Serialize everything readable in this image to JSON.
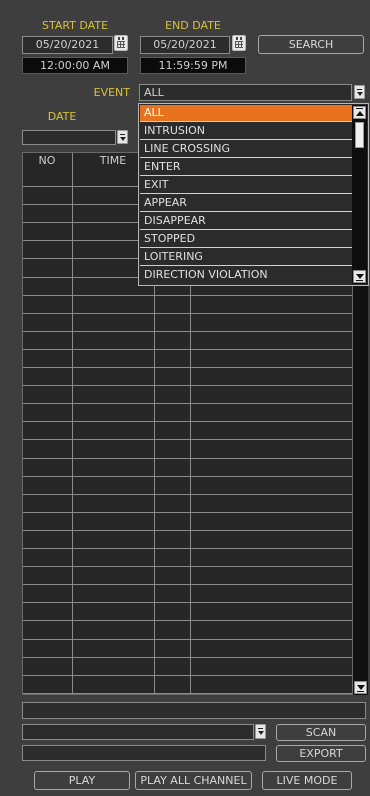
{
  "search": {
    "start_date_label": "START DATE",
    "end_date_label": "END DATE",
    "start_date": "05/20/2021",
    "end_date": "05/20/2021",
    "start_time": "12:00:00 AM",
    "end_time": "11:59:59 PM",
    "search_button": "SEARCH",
    "calendar_icon": "calendar-icon"
  },
  "filters": {
    "event_label": "EVENT",
    "event_value": "ALL",
    "date_label": "DATE",
    "date_value": ""
  },
  "event_dropdown": {
    "open": true,
    "selected": "ALL",
    "options": [
      "ALL",
      "INTRUSION",
      "LINE CROSSING",
      "ENTER",
      "EXIT",
      "APPEAR",
      "DISAPPEAR",
      "STOPPED",
      "LOITERING",
      "DIRECTION VIOLATION"
    ]
  },
  "table": {
    "columns": [
      "NO",
      "TIME"
    ],
    "rows": []
  },
  "footer": {
    "info_value": "",
    "channel_value": "",
    "export_path": "",
    "scan_button": "SCAN",
    "export_button": "EXPORT",
    "play_button": "PLAY",
    "play_all_button": "PLAY ALL CHANNEL",
    "live_mode_button": "LIVE MODE"
  },
  "colors": {
    "background": "#3e3e3e",
    "label_yellow": "#d8c23a",
    "selected_orange": "#e8731e"
  }
}
